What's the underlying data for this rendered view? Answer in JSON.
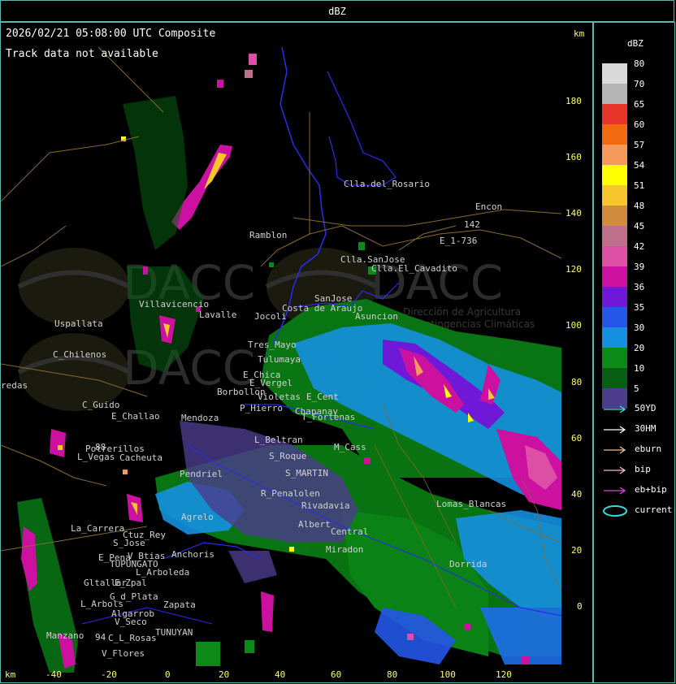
{
  "title": "dBZ",
  "timestamp_label": "2026/02/21 05:08:00 UTC Composite",
  "track_status": "Track data not available",
  "axis_unit_top": "km",
  "axis_unit_bottom": "km",
  "legend": {
    "title": "dBZ",
    "scale": [
      {
        "value": "80",
        "color": "#d9d9d9"
      },
      {
        "value": "70",
        "color": "#b5b5b5"
      },
      {
        "value": "65",
        "color": "#e8352a"
      },
      {
        "value": "60",
        "color": "#f26a10"
      },
      {
        "value": "57",
        "color": "#f59a5c"
      },
      {
        "value": "54",
        "color": "#ffff00"
      },
      {
        "value": "51",
        "color": "#f6c62c"
      },
      {
        "value": "48",
        "color": "#d08c3c"
      },
      {
        "value": "45",
        "color": "#bd6f8c"
      },
      {
        "value": "42",
        "color": "#dd4fa5"
      },
      {
        "value": "39",
        "color": "#cc10a0"
      },
      {
        "value": "36",
        "color": "#7018d8"
      },
      {
        "value": "35",
        "color": "#2456e8"
      },
      {
        "value": "30",
        "color": "#1590e0"
      },
      {
        "value": "20",
        "color": "#0b8a18"
      },
      {
        "value": "10",
        "color": "#065e12"
      },
      {
        "value": "5",
        "color": "#4c3c8c"
      }
    ],
    "tracks": [
      {
        "label": "50YD",
        "color": "#40e0e0"
      },
      {
        "label": "30HM",
        "color": "#ffffff"
      },
      {
        "label": "eburn",
        "color": "#f0c070"
      },
      {
        "label": "bip",
        "color": "#f4b8c8"
      },
      {
        "label": "eb+bip",
        "color": "#e040e0"
      },
      {
        "label": "current",
        "color": "#30e0e0"
      }
    ]
  },
  "y_ticks": [
    "180",
    "160",
    "140",
    "120",
    "100",
    "80",
    "60",
    "40",
    "20",
    "0"
  ],
  "x_ticks": [
    "-40",
    "-20",
    "0",
    "20",
    "40",
    "60",
    "80",
    "100",
    "120"
  ],
  "watermark": {
    "logo_text": "DACC",
    "subtitle_1": "Dirección de Agricultura",
    "subtitle_2": "y Contingencias Climáticas"
  },
  "places": [
    {
      "name": "Clla.del_Rosario"
    },
    {
      "name": "Encon"
    },
    {
      "name": "142"
    },
    {
      "name": "E_1-736"
    },
    {
      "name": "Ramblon"
    },
    {
      "name": "Clla.SanJose"
    },
    {
      "name": "Clla.El_Cavadito"
    },
    {
      "name": "SanJose"
    },
    {
      "name": "Uspallata"
    },
    {
      "name": "Villavicencio"
    },
    {
      "name": "Lavalle"
    },
    {
      "name": "Jocoli"
    },
    {
      "name": "Costa de Araujo"
    },
    {
      "name": "Asuncion"
    },
    {
      "name": "C_Chilenos"
    },
    {
      "name": "Tres_Mayo"
    },
    {
      "name": "Tulumaya"
    },
    {
      "name": "E_Chica"
    },
    {
      "name": "E_Vergel"
    },
    {
      "name": "Borbollon"
    },
    {
      "name": "Violetas"
    },
    {
      "name": "E_Cent"
    },
    {
      "name": "P_Hierro"
    },
    {
      "name": "redas"
    },
    {
      "name": "C_Guido"
    },
    {
      "name": "E_Challao"
    },
    {
      "name": "Mendoza"
    },
    {
      "name": "T_Fortenas"
    },
    {
      "name": "Chapanay"
    },
    {
      "name": "L_Beltran"
    },
    {
      "name": "M_Cass"
    },
    {
      "name": "Potrerillos"
    },
    {
      "name": "L_Vegas"
    },
    {
      "name": "Cacheuta"
    },
    {
      "name": "Pendriel"
    },
    {
      "name": "S_Roque"
    },
    {
      "name": "S_MARTIN"
    },
    {
      "name": "R_Penalolen"
    },
    {
      "name": "Agrelo"
    },
    {
      "name": "Rivadavia"
    },
    {
      "name": "Lomas_Blancas"
    },
    {
      "name": "La_Carrera"
    },
    {
      "name": "Ctuz_Rey"
    },
    {
      "name": "S_Jose"
    },
    {
      "name": "Albert"
    },
    {
      "name": "Central"
    },
    {
      "name": "E_Pena"
    },
    {
      "name": "V_Btias"
    },
    {
      "name": "Anchoris"
    },
    {
      "name": "TUPUNGATO"
    },
    {
      "name": "L_Arboleda"
    },
    {
      "name": "Miradon"
    },
    {
      "name": "Dorrida"
    },
    {
      "name": "Gltallar"
    },
    {
      "name": "E_Zpal"
    },
    {
      "name": "L_Arbols"
    },
    {
      "name": "G_d_Plata"
    },
    {
      "name": "Zapata"
    },
    {
      "name": "Algarrob"
    },
    {
      "name": "V_Seco"
    },
    {
      "name": "TUNUYAN"
    },
    {
      "name": "Manzano"
    },
    {
      "name": "C_L_Rosas"
    },
    {
      "name": "V_Flores"
    },
    {
      "name": "88"
    },
    {
      "name": "94"
    }
  ]
}
